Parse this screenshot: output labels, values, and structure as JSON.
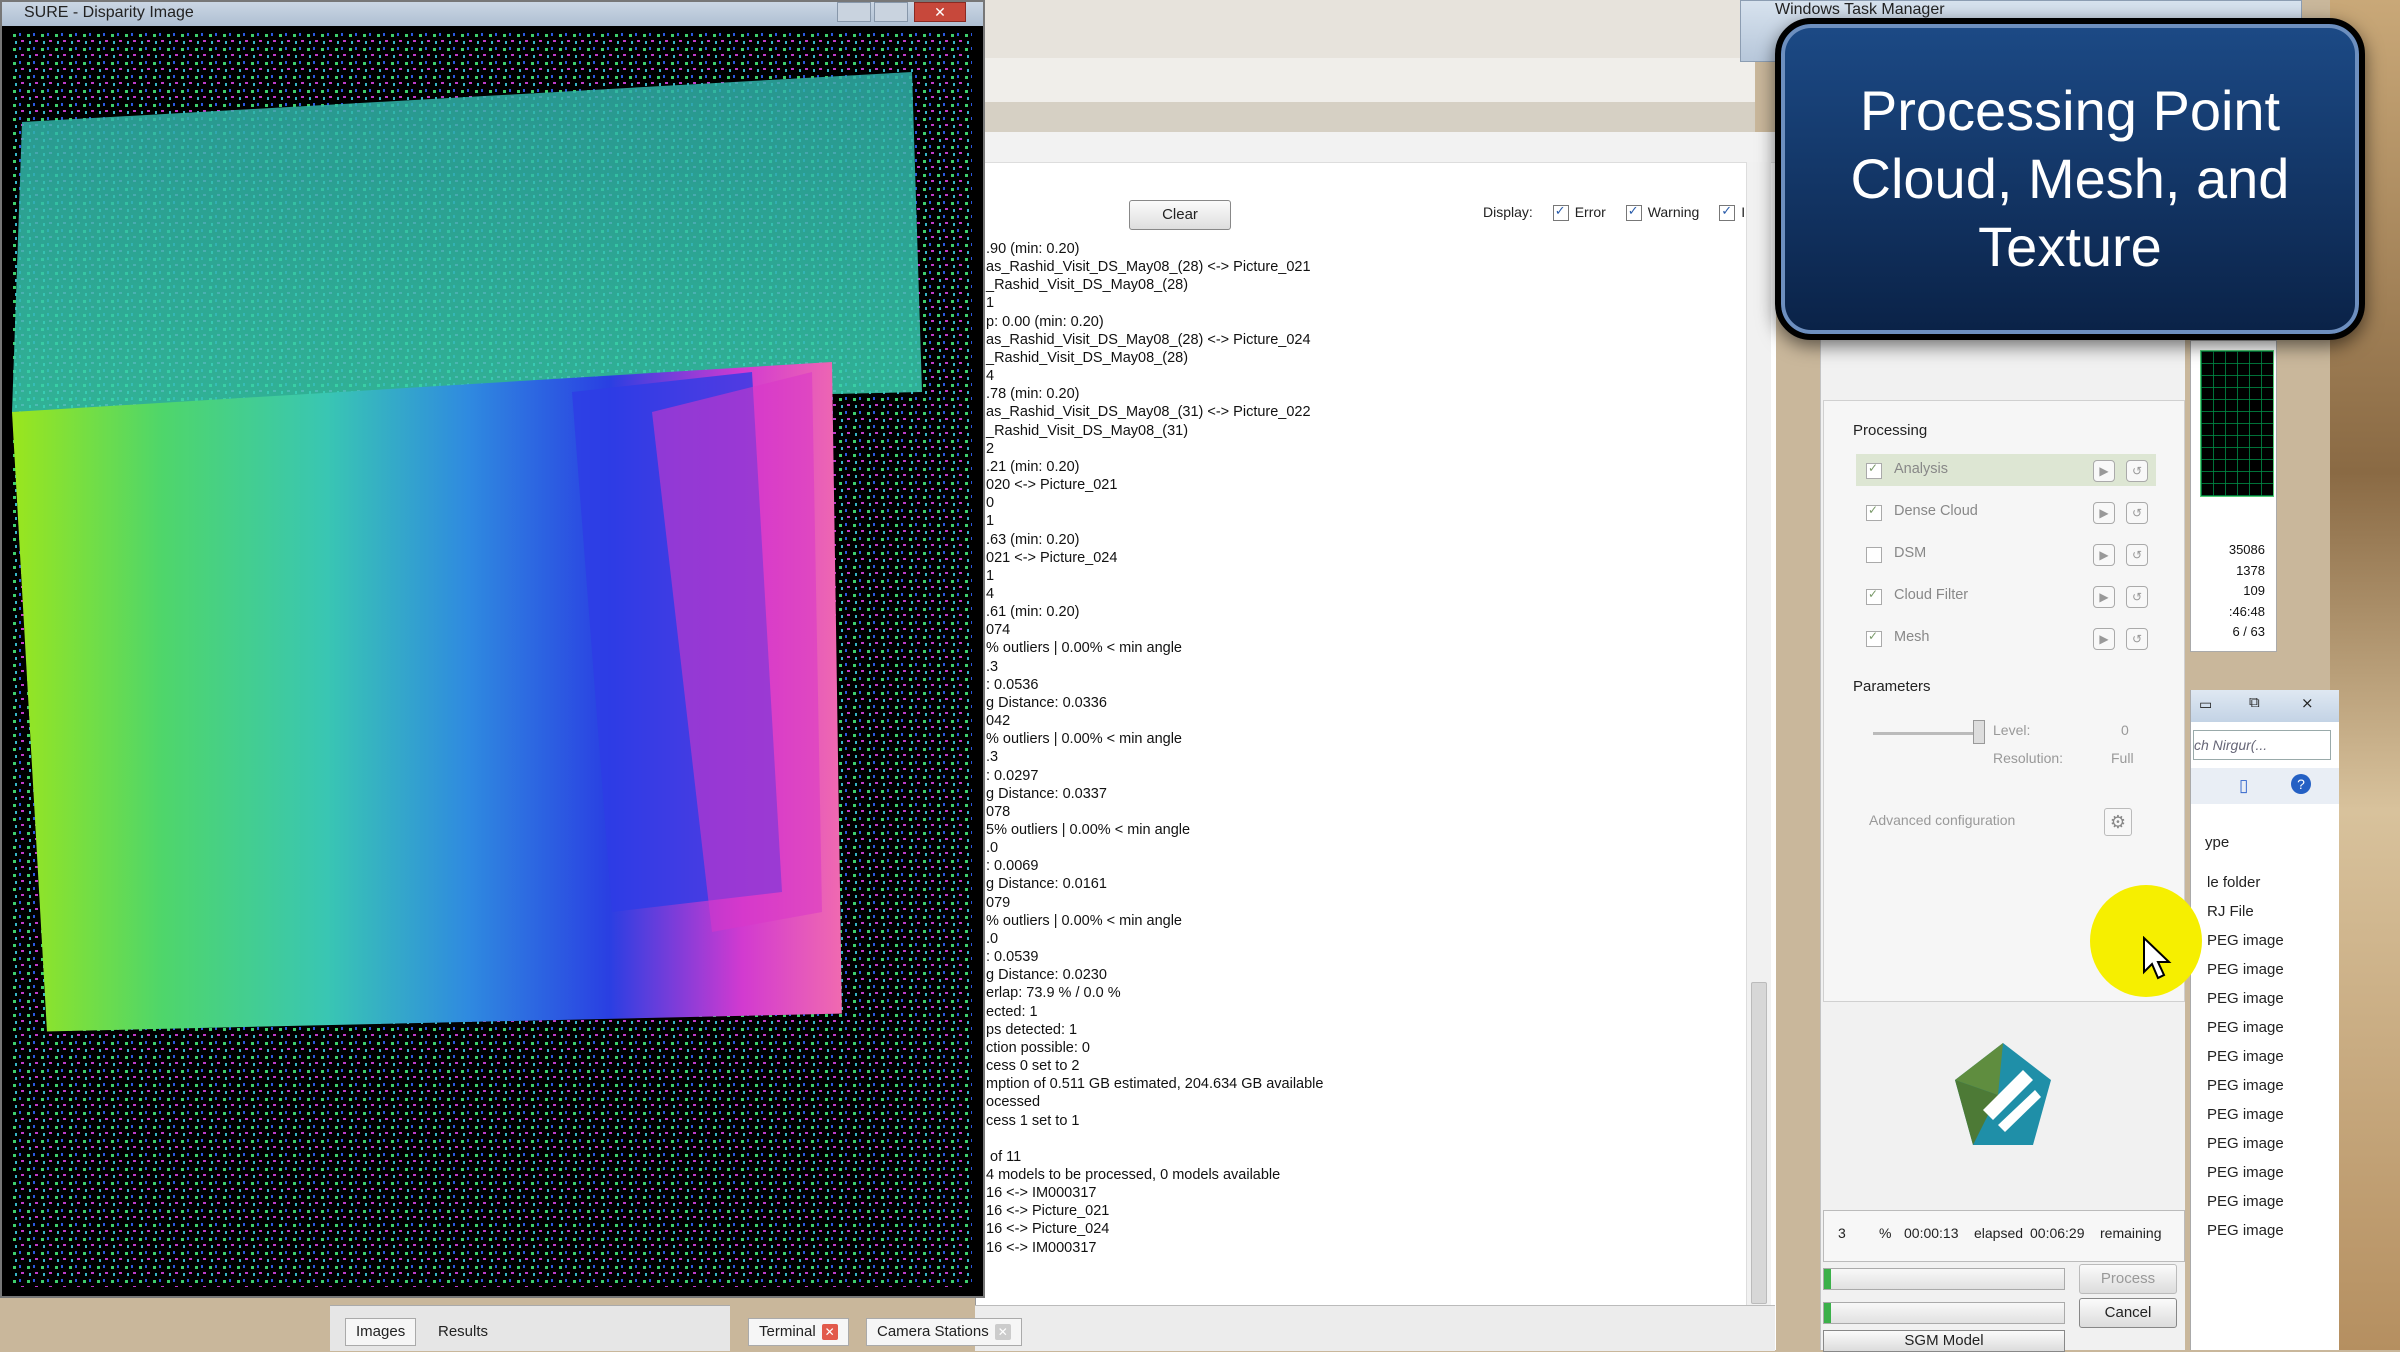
{
  "sure_window": {
    "title": "SURE - Disparity Image",
    "close_glyph": "✕"
  },
  "task_manager": {
    "title": "Windows Task Manager",
    "stats": [
      "35086",
      "1378",
      "109",
      ":46:48",
      "6 / 63"
    ]
  },
  "console": {
    "clear_label": "Clear",
    "display_label": "Display:",
    "filters": [
      {
        "label": "Error",
        "checked": true
      },
      {
        "label": "Warning",
        "checked": true
      },
      {
        "label": "Info",
        "checked": true
      }
    ],
    "log_lines": [
      ".90 (min: 0.20)",
      "as_Rashid_Visit_DS_May08_(28) <-> Picture_021",
      "_Rashid_Visit_DS_May08_(28)",
      "1",
      "p: 0.00 (min: 0.20)",
      "as_Rashid_Visit_DS_May08_(28) <-> Picture_024",
      "_Rashid_Visit_DS_May08_(28)",
      "4",
      ".78 (min: 0.20)",
      "as_Rashid_Visit_DS_May08_(31) <-> Picture_022",
      "_Rashid_Visit_DS_May08_(31)",
      "2",
      ".21 (min: 0.20)",
      "020 <-> Picture_021",
      "0",
      "1",
      ".63 (min: 0.20)",
      "021 <-> Picture_024",
      "1",
      "4",
      ".61 (min: 0.20)",
      "074",
      "% outliers | 0.00% < min angle",
      ".3",
      ": 0.0536",
      "g Distance: 0.0336",
      "042",
      "% outliers | 0.00% < min angle",
      ".3",
      ": 0.0297",
      "g Distance: 0.0337",
      "078",
      "5% outliers | 0.00% < min angle",
      ".0",
      ": 0.0069",
      "g Distance: 0.0161",
      "079",
      "% outliers | 0.00% < min angle",
      ".0",
      ": 0.0539",
      "g Distance: 0.0230",
      "erlap: 73.9 % / 0.0 %",
      "ected: 1",
      "ps detected: 1",
      "ction possible: 0",
      "cess 0 set to 2",
      "mption of 0.511 GB estimated, 204.634 GB available",
      "ocessed",
      "cess 1 set to 1",
      "",
      " of 11",
      "4 models to be processed, 0 models available",
      "16 <-> IM000317",
      "16 <-> Picture_021",
      "16 <-> Picture_024",
      "16 <-> IM000317"
    ]
  },
  "bottom_tabs": {
    "images": "Images",
    "results": "Results",
    "terminal": "Terminal",
    "camera_stations": "Camera Stations",
    "close_glyph": "✕"
  },
  "callout": {
    "text": "Processing Point Cloud, Mesh, and Texture"
  },
  "processing_panel": {
    "processing_title": "Processing",
    "steps": [
      {
        "label": "Analysis",
        "checked": true,
        "active": true
      },
      {
        "label": "Dense Cloud",
        "checked": true,
        "active": false
      },
      {
        "label": "DSM",
        "checked": false,
        "active": false
      },
      {
        "label": "Cloud Filter",
        "checked": true,
        "active": false
      },
      {
        "label": "Mesh",
        "checked": true,
        "active": false
      }
    ],
    "parameters_title": "Parameters",
    "level_label": "Level:",
    "level_value": "0",
    "resolution_label": "Resolution:",
    "resolution_value": "Full",
    "advanced_label": "Advanced configuration",
    "progress": {
      "percent_value": "3",
      "percent_sign": "%",
      "elapsed": "00:00:13",
      "elapsed_label": "elapsed",
      "remaining": "00:06:29",
      "remaining_label": "remaining"
    },
    "process_button": "Process",
    "cancel_button": "Cancel",
    "model_label": "SGM Model",
    "bar1_fill": 0.03,
    "bar2_fill": 0.03
  },
  "explorer": {
    "search_placeholder": "ch Nirgur(...",
    "type_header": "ype",
    "items": [
      "le folder",
      "RJ File",
      "PEG image",
      "PEG image",
      "PEG image",
      "PEG image",
      "PEG image",
      "PEG image",
      "PEG image",
      "PEG image",
      "PEG image",
      "PEG image",
      "PEG image"
    ]
  },
  "colors": {
    "callout_bg": "#1c4a86",
    "progress_green": "#3bb04a",
    "cursor_highlight": "#f6ef00"
  }
}
